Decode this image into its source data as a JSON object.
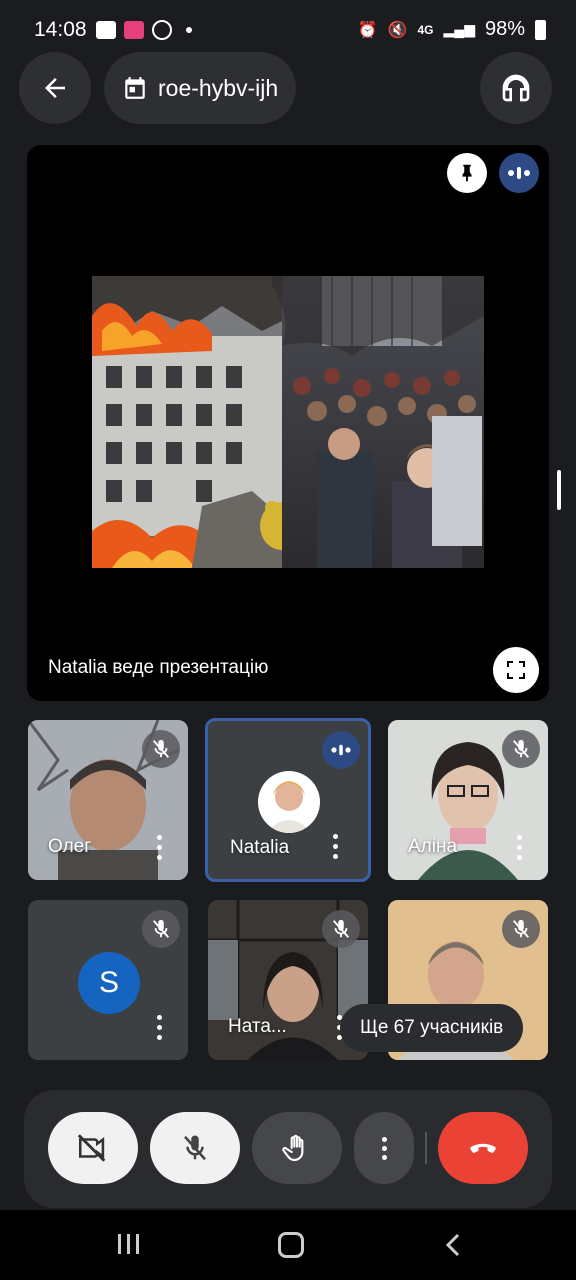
{
  "status_bar": {
    "time": "14:08",
    "battery": "98%",
    "network": "4G"
  },
  "meeting": {
    "code": "roe-hybv-ijh"
  },
  "presentation": {
    "caption": "Natalia веде презентацію"
  },
  "participants": [
    {
      "name": "Олег"
    },
    {
      "name": "Natalia"
    },
    {
      "name": "Аліна"
    },
    {
      "name": "S"
    },
    {
      "name": "Ната..."
    }
  ],
  "more_participants": "Ще 67 учасників",
  "colors": {
    "end_call": "#ea4335",
    "accent_blue": "#2d4a85",
    "speaking_border": "#3c5fa8"
  },
  "icons": [
    "back-arrow-icon",
    "calendar-icon",
    "headphones-icon",
    "pin-icon",
    "speaking-icon",
    "fullscreen-icon",
    "mic-off-icon",
    "more-vert-icon",
    "video-off-icon",
    "raise-hand-icon",
    "end-call-icon"
  ]
}
